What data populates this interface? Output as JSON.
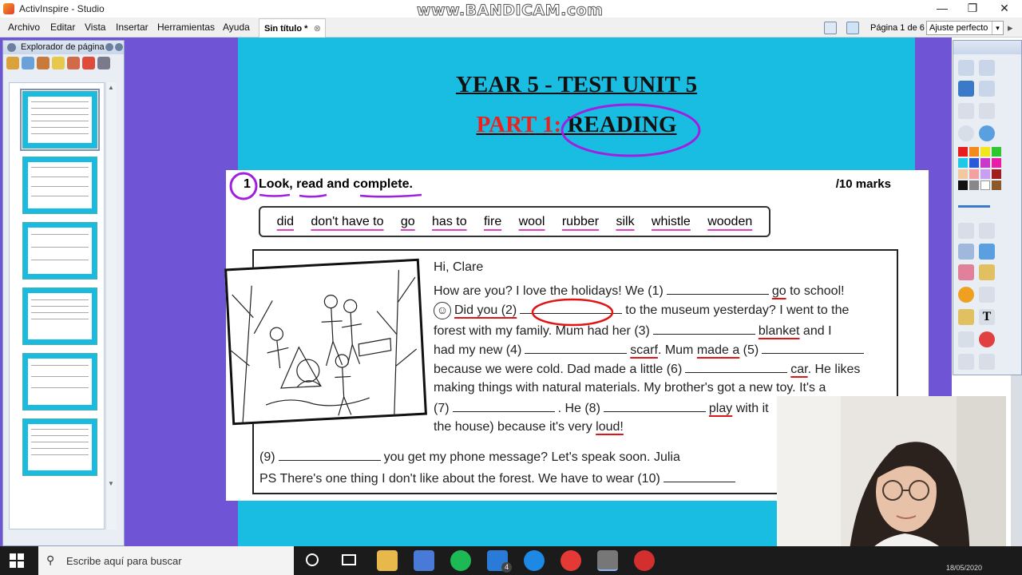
{
  "window": {
    "title": "ActivInspire - Studio",
    "watermark": "www.BANDICAM.com",
    "minimize": "—",
    "maximize": "❐",
    "close": "✕"
  },
  "menu": {
    "items": [
      "Archivo",
      "Editar",
      "Vista",
      "Insertar",
      "Herramientas",
      "Ayuda"
    ],
    "doc_tab": "Sin título *",
    "doc_tab_close": "⊗",
    "page_indicator": "Página 1 de 6",
    "zoom": "Ajuste perfecto",
    "zoom_arrow": "▾"
  },
  "explorer": {
    "title": "Explorador de página",
    "pages": 6,
    "selected": 1
  },
  "slide": {
    "title": "YEAR 5 - TEST UNIT 5",
    "part_label": "PART 1:",
    "part_name": "READING",
    "exercise_number": "1",
    "instruction": "Look, read and complete.",
    "marks": "/10 marks",
    "word_bank": [
      "did",
      "don't have to",
      "go",
      "has to",
      "fire",
      "wool",
      "rubber",
      "silk",
      "whistle",
      "wooden"
    ],
    "letter": {
      "greeting": "Hi, Clare",
      "l1a": "How are you? I love the holidays! We (1)",
      "l1b": "go",
      "l1c": " to school!",
      "l2a": "Did you (2)",
      "l2b": "to the museum yesterday? I went to the",
      "l3a": "forest with my family. Mum had her (3)",
      "l3b": "blanket",
      "l3c": " and I",
      "l4a": "had my new (4)",
      "l4b": "scarf",
      "l4c": ". Mum",
      "l4d": "made a",
      "l4e": " (5)",
      "l5a": "because we were cold. Dad made a little (6)",
      "l5b": "car",
      "l5c": ". He likes",
      "l6": "making things with natural materials. My brother's got a new toy. It's a",
      "l7a": "(7)",
      "l7b": ". He (8)",
      "l7c": "play",
      "l7d": " with it",
      "l8a": "the house) because it's very ",
      "l8b": "loud!",
      "l9a": "(9)",
      "l9b": "you get my phone message? Let's speak soon. Julia",
      "l10": "PS There's one thing I don't like about the forest. We have to wear (10)"
    }
  },
  "taskbar": {
    "search_placeholder": "Escribe aquí para buscar",
    "mail_badge": "4",
    "clock": "18/05/2020"
  },
  "colors": {
    "slide_bg": "#19bde1",
    "canvas_bg": "#6f55d6",
    "annotation_purple": "#a020e0",
    "annotation_red": "#e01515",
    "annotation_pink": "#e040c8"
  }
}
